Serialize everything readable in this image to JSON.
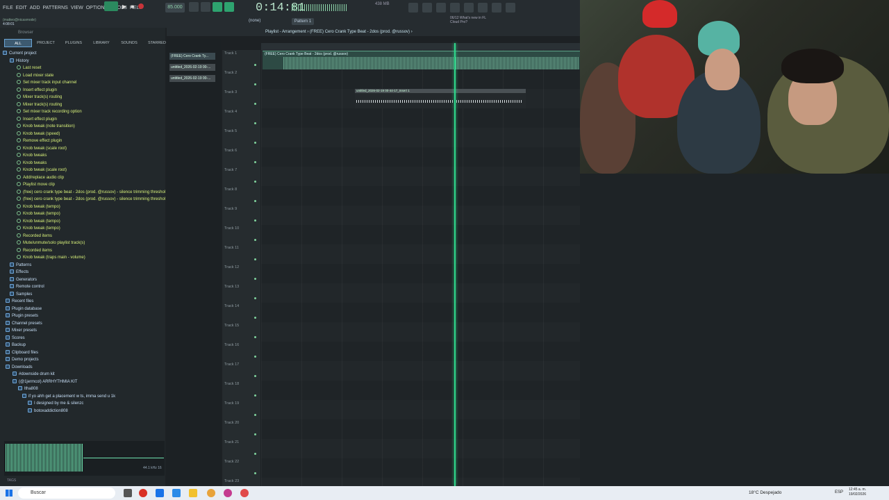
{
  "menu": {
    "items": [
      "FILE",
      "EDIT",
      "ADD",
      "PATTERNS",
      "VIEW",
      "OPTIONS",
      "TOOLS",
      "HELP"
    ]
  },
  "transport": {
    "tempo": "85.000",
    "time": "0:14:81",
    "pattern": "Pattern 1",
    "snap": "(none)",
    "cpu_ram": "438 MB",
    "hint": "06/12 What's new in FL Cloud Pro?"
  },
  "project": {
    "user": "(matteo@nicasmode)",
    "time": "4:08:01"
  },
  "browser": {
    "title": "Browser",
    "tabs": [
      "ALL",
      "PROJECT",
      "PLUGINS",
      "LIBRARY",
      "SOUNDS",
      "STARRED"
    ],
    "items": [
      {
        "label": "Current project",
        "type": "f",
        "indent": 4
      },
      {
        "label": "History",
        "type": "f",
        "indent": 14
      },
      {
        "label": "Last reset",
        "type": "h",
        "indent": 24
      },
      {
        "label": "Load mixer state",
        "type": "h",
        "indent": 24
      },
      {
        "label": "Set mixer track input channel",
        "type": "h",
        "indent": 24
      },
      {
        "label": "Insert effect plugin",
        "type": "h",
        "indent": 24
      },
      {
        "label": "Mixer track(s) routing",
        "type": "h",
        "indent": 24
      },
      {
        "label": "Mixer track(s) routing",
        "type": "h",
        "indent": 24
      },
      {
        "label": "Set mixer track recording option",
        "type": "h",
        "indent": 24
      },
      {
        "label": "Insert effect plugin",
        "type": "h",
        "indent": 24
      },
      {
        "label": "Knob tweak (note transition)",
        "type": "h",
        "indent": 24
      },
      {
        "label": "Knob tweak (speed)",
        "type": "h",
        "indent": 24
      },
      {
        "label": "Remove effect plugin",
        "type": "h",
        "indent": 24
      },
      {
        "label": "Knob tweak (scale root)",
        "type": "h",
        "indent": 24
      },
      {
        "label": "Knob tweaks",
        "type": "h",
        "indent": 24
      },
      {
        "label": "Knob tweaks",
        "type": "h",
        "indent": 24
      },
      {
        "label": "Knob tweak (scale root)",
        "type": "h",
        "indent": 24
      },
      {
        "label": "Add/replace audio clip",
        "type": "h",
        "indent": 24
      },
      {
        "label": "Playlist move clip",
        "type": "h",
        "indent": 24
      },
      {
        "label": "(free) cero  crank type beat - 2dos (prod. @russov) - silence trimming threshold",
        "type": "h",
        "indent": 24
      },
      {
        "label": "(free) cero  crank type beat - 2dos (prod. @russov) - silence trimming threshold",
        "type": "h",
        "indent": 24
      },
      {
        "label": "Knob tweak (tempo)",
        "type": "h",
        "indent": 24
      },
      {
        "label": "Knob tweak (tempo)",
        "type": "h",
        "indent": 24
      },
      {
        "label": "Knob tweak (tempo)",
        "type": "h",
        "indent": 24
      },
      {
        "label": "Knob tweak (tempo)",
        "type": "h",
        "indent": 24
      },
      {
        "label": "Recorded items",
        "type": "h",
        "indent": 24
      },
      {
        "label": "Mute/unmute/solo playlist track(s)",
        "type": "h",
        "indent": 24
      },
      {
        "label": "Recorded items",
        "type": "h",
        "indent": 24
      },
      {
        "label": "Knob tweak (traps main - volume)",
        "type": "h",
        "indent": 24
      },
      {
        "label": "Patterns",
        "type": "f",
        "indent": 14
      },
      {
        "label": "Effects",
        "type": "f",
        "indent": 14
      },
      {
        "label": "Generators",
        "type": "f",
        "indent": 14
      },
      {
        "label": "Remote control",
        "type": "f",
        "indent": 14
      },
      {
        "label": "Samples",
        "type": "f",
        "indent": 14
      },
      {
        "label": "Recent files",
        "type": "f",
        "indent": 8
      },
      {
        "label": "Plugin database",
        "type": "f",
        "indent": 8
      },
      {
        "label": "Plugin presets",
        "type": "f",
        "indent": 8
      },
      {
        "label": "Channel presets",
        "type": "f",
        "indent": 8
      },
      {
        "label": "Mixer presets",
        "type": "f",
        "indent": 8
      },
      {
        "label": "Scores",
        "type": "f",
        "indent": 8
      },
      {
        "label": "Backup",
        "type": "f",
        "indent": 8
      },
      {
        "label": "Clipboard files",
        "type": "f",
        "indent": 8
      },
      {
        "label": "Demo projects",
        "type": "f",
        "indent": 8
      },
      {
        "label": "Downloads",
        "type": "f",
        "indent": 8
      },
      {
        "label": "#downside drum kit",
        "type": "f",
        "indent": 18
      },
      {
        "label": "(@1jermcol) ARRHYTHMIA KIT",
        "type": "f",
        "indent": 18
      },
      {
        "label": "ltha808",
        "type": "f",
        "indent": 26
      },
      {
        "label": "if yo ahh get a placement w ts, imma send u 1k",
        "type": "f",
        "indent": 32
      },
      {
        "label": "I designed by me & silenzc",
        "type": "f",
        "indent": 40
      },
      {
        "label": "botoxaddiction808",
        "type": "f",
        "indent": 40
      }
    ],
    "scope_info": "44.1 kHz 16",
    "tags": "TAGS"
  },
  "playlist": {
    "title": "Playlist - Arrangement  ›  (FREE) Cero  Crank Type Beat - 2dos (prod. @russov)  ›",
    "clip_list": [
      "(FREE) Cero  Crank Ty...",
      "untitled_2026-02-19 00-...",
      "untitled_2026-02-19 00-..."
    ],
    "tracks": [
      "Track 1",
      "Track 2",
      "Track 3",
      "Track 4",
      "Track 5",
      "Track 6",
      "Track 7",
      "Track 8",
      "Track 9",
      "Track 10",
      "Track 11",
      "Track 12",
      "Track 13",
      "Track 14",
      "Track 15",
      "Track 16",
      "Track 17",
      "Track 18",
      "Track 19",
      "Track 20",
      "Track 21",
      "Track 22",
      "Track 23"
    ],
    "clip1": "(FREE) Cero  Crank Type Beat - 2dos (prod. @russov)",
    "clip2": "untitled_2026-02-19 00-44-17_Insert 1",
    "playhead_fraction": 0.605
  },
  "taskbar": {
    "search_placeholder": "Buscar",
    "weather": "18°C  Despejado",
    "lang": "ESP",
    "time": "12:45 a. m.",
    "date": "19/02/2026"
  }
}
